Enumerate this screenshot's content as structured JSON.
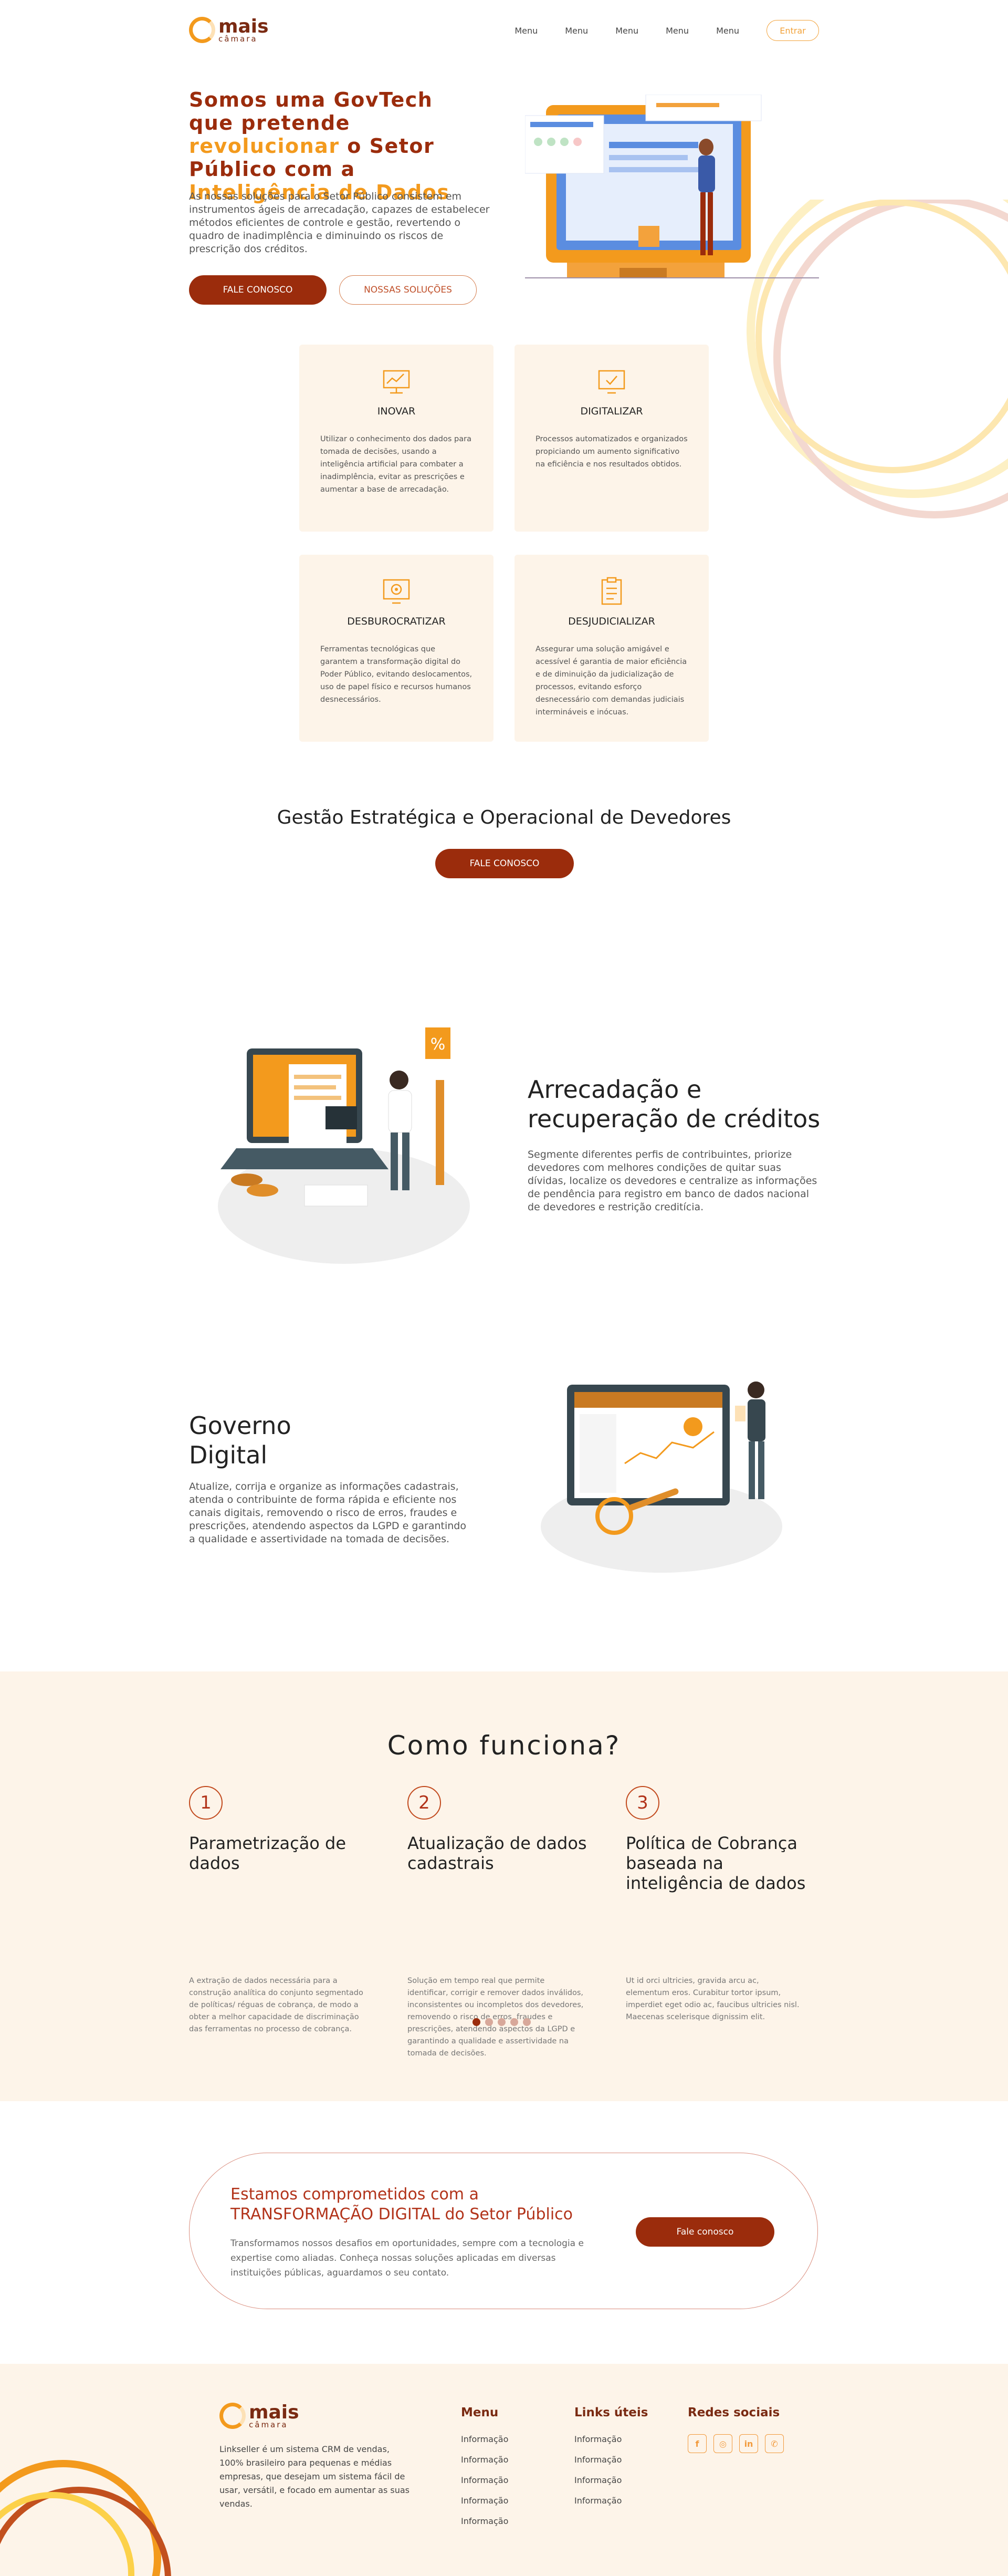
{
  "brand": {
    "name": "mais",
    "sub": "câmara"
  },
  "nav": {
    "items": [
      "Menu",
      "Menu",
      "Menu",
      "Menu",
      "Menu"
    ],
    "enter": "Entrar"
  },
  "hero": {
    "title_1": "Somos uma GovTech que pretende ",
    "title_hl1": "revolucionar",
    "title_2": " o Setor Público com a ",
    "title_hl2": "Inteligência de Dados",
    "lead": "As nossas soluções para o Setor Público consistem em instrumentos ágeis de arrecadação, capazes de estabelecer métodos eficientes de controle e gestão, revertendo o quadro de inadimplência e diminuindo os riscos de prescrição dos créditos.",
    "btn_contact": "FALE CONOSCO",
    "btn_solutions": "NOSSAS SOLUÇÕES"
  },
  "features": [
    {
      "title": "INOVAR",
      "icon": "innovation-icon",
      "text": "Utilizar o conhecimento dos dados para tomada de decisões, usando a inteligência artificial para combater a inadimplência, evitar as prescrições e aumentar  a base de arrecadação."
    },
    {
      "title": "DIGITALIZAR",
      "icon": "digital-icon",
      "text": "Processos automatizados e organizados propiciando um aumento significativo na eficiência e nos resultados obtidos."
    },
    {
      "title": "DESBUROCRATIZAR",
      "icon": "gear-icon",
      "text": "Ferramentas tecnológicas que garantem a transformação digital do Poder Público, evitando deslocamentos, uso de papel físico e recursos humanos desnecessários."
    },
    {
      "title": "DESJUDICIALIZAR",
      "icon": "clipboard-icon",
      "text": "Assegurar uma solução amigável e acessível é garantia de maior eficiência e de diminuição da judicialização de processos, evitando esforço desnecessário com demandas judiciais intermináveis e inócuas."
    }
  ],
  "gestao": {
    "title": "Gestão Estratégica e Operacional de Devedores",
    "btn": "FALE CONOSCO"
  },
  "services": [
    {
      "title": "Arrecadação e recuperação de créditos",
      "text": "Segmente diferentes perfis de contribuintes, priorize devedores com melhores condições de quitar suas dívidas, localize os devedores e centralize as informações de pendência para registro em banco de dados nacional de devedores e restrição creditícia."
    },
    {
      "title": "Governo Digital",
      "text": "Atualize, corrija e organize as informações cadastrais, atenda o contribuinte de forma rápida e eficiente nos canais digitais, removendo o risco de erros, fraudes e prescrições, atendendo aspectos da LGPD e garantindo a qualidade e assertividade na tomada de decisões."
    }
  ],
  "how": {
    "title": "Como funciona?",
    "steps": [
      {
        "n": "1",
        "title": "Parametrização de dados",
        "text": "A extração de dados necessária para a construção analítica do conjunto segmentado de políticas/ réguas de cobrança, de modo a obter a melhor capacidade de discriminação das ferramentas no processo de cobrança."
      },
      {
        "n": "2",
        "title": "Atualização de dados cadastrais",
        "text": "Solução em tempo real que permite identificar, corrigir e remover dados inválidos, inconsistentes ou incompletos dos devedores, removendo o risco de erros, fraudes e prescrições, atendendo aspectos da LGPD e garantindo a qualidade e assertividade na tomada de decisões."
      },
      {
        "n": "3",
        "title": "Política de Cobrança baseada na inteligência de dados",
        "text": "Ut id orci ultricies, gravida arcu ac, elementum eros. Curabitur tortor ipsum, imperdiet eget odio ac, faucibus ultricies nisl. Maecenas scelerisque dignissim elit."
      }
    ],
    "active_slide": 1,
    "slides": 5
  },
  "cta": {
    "title_1": "Estamos comprometidos com a",
    "title_2": "TRANSFORMAÇÃO DIGITAL do Setor Público",
    "text": "Transformamos nossos desafios em oportunidades, sempre com a tecnologia e expertise como aliadas. Conheça nossas soluções aplicadas em diversas instituições públicas, aguardamos o seu contato.",
    "btn": "Fale conosco"
  },
  "footer": {
    "about": "Linkseller é um sistema CRM de vendas, 100% brasileiro para pequenas e médias empresas, que desejam um sistema fácil de usar, versátil, e focado em aumentar as suas vendas.",
    "menu_title": "Menu",
    "menu": [
      "Informação",
      "Informação",
      "Informação",
      "Informação",
      "Informação"
    ],
    "links_title": "Links úteis",
    "links": [
      "Informação",
      "Informação",
      "Informação",
      "Informação"
    ],
    "social_title": "Redes sociais",
    "social": [
      "facebook-icon",
      "instagram-icon",
      "linkedin-icon",
      "whatsapp-icon"
    ]
  },
  "colors": {
    "primary": "#9b2c0c",
    "accent": "#f39a1d",
    "cream": "#fdf4e9"
  }
}
